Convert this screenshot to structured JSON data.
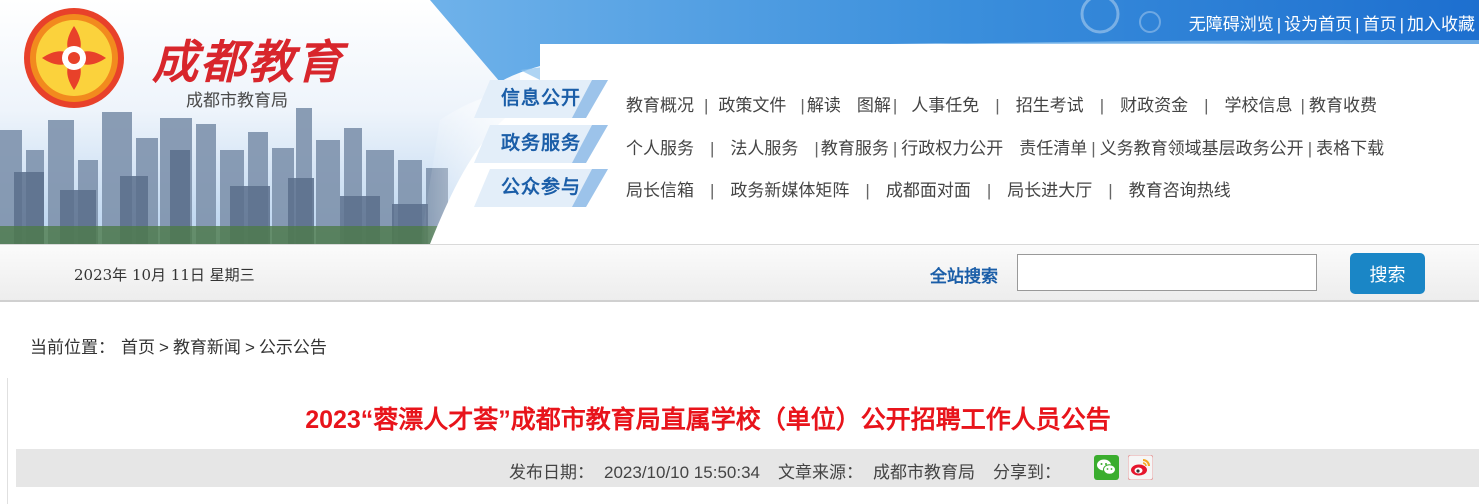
{
  "header": {
    "site_title": "成都教育",
    "site_subtitle": "成都市教育局",
    "top_links": [
      "无障碍浏览",
      "设为首页",
      "首页",
      "加入收藏"
    ]
  },
  "nav": {
    "tabs": [
      "信息公开",
      "政务服务",
      "公众参与"
    ],
    "row1": [
      "教育概况",
      "政策文件",
      "解读",
      "图解",
      "人事任免",
      "招生考试",
      "财政资金",
      "学校信息",
      "教育收费"
    ],
    "row2": [
      "个人服务",
      "法人服务",
      "教育服务",
      "行政权力公开",
      "责任清单",
      "义务教育领域基层政务公开",
      "表格下载"
    ],
    "row3": [
      "局长信箱",
      "政务新媒体矩阵",
      "成都面对面",
      "局长进大厅",
      "教育咨询热线"
    ]
  },
  "search": {
    "date_text": "2023年  10月  11日  星期三",
    "label": "全站搜索",
    "value": "",
    "button": "搜索"
  },
  "breadcrumb": {
    "prefix": "当前位置：",
    "items": [
      "首页",
      "教育新闻",
      "公示公告"
    ],
    "separator": ">"
  },
  "article": {
    "title": "2023“蓉漂人才荟”成都市教育局直属学校（单位）公开招聘工作人员公告",
    "publish_label": "发布日期：",
    "publish_date": "2023/10/10 15:50:34",
    "source_label": "文章来源：",
    "source": "成都市教育局",
    "share_label": "分享到："
  },
  "colors": {
    "brand_red": "#d8262c",
    "title_red": "#e8141b",
    "nav_blue": "#1b5ea8",
    "button_blue": "#1a86c6",
    "banner_blue": "#2f8ad8"
  },
  "icons": [
    "logo-emblem",
    "wechat-icon",
    "weibo-icon"
  ]
}
